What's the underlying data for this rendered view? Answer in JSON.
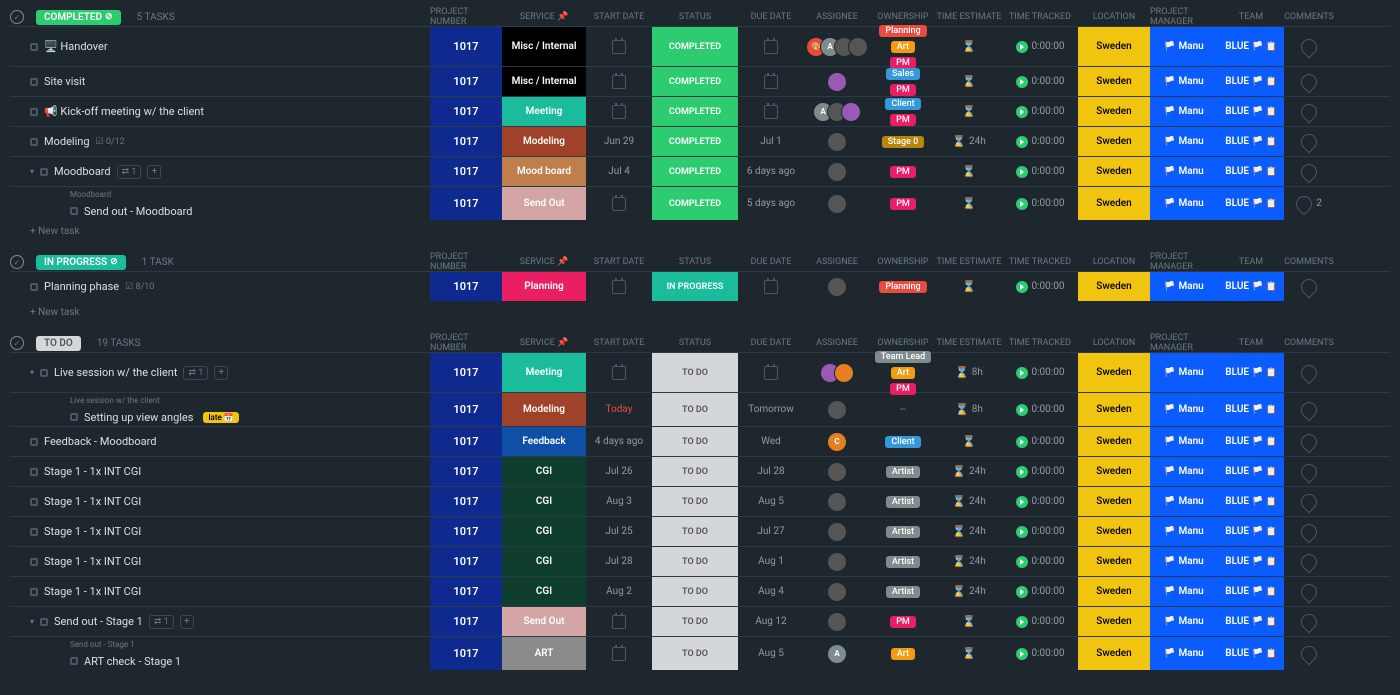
{
  "columns": {
    "project_number": "PROJECT NUMBER",
    "service": "SERVICE",
    "start_date": "START DATE",
    "status": "STATUS",
    "due_date": "DUE DATE",
    "assignee": "ASSIGNEE",
    "ownership": "OWNERSHIP",
    "time_estimate": "TIME ESTIMATE",
    "time_tracked": "TIME TRACKED",
    "location": "LOCATION",
    "project_manager": "PROJECT MANAGER",
    "team": "TEAM",
    "comments": "COMMENTS"
  },
  "new_task": "+ New task",
  "late_label": "late",
  "location_value": "Sweden",
  "pm_value": "Manu",
  "team_value": "BLUE",
  "tracked_default": "0:00:00",
  "groups": [
    {
      "name": "COMPLETED",
      "pill_class": "completed",
      "count": "5 TASKS",
      "tasks": [
        {
          "name": "🖥️ Handover",
          "proj": "1017",
          "service": "Misc / Internal",
          "service_bg": "#000",
          "start": "",
          "status": "COMPLETED",
          "status_bg": "#2ecc71",
          "due": "",
          "assignee": "group4",
          "ownership": [
            {
              "t": "Planning",
              "c": "#e74c3c"
            },
            {
              "t": "Art",
              "c": "#f39c12"
            },
            {
              "t": "PM",
              "c": "#e91e63"
            }
          ],
          "estimate": "",
          "tall": true
        },
        {
          "name": "Site visit",
          "proj": "1017",
          "service": "Misc / Internal",
          "service_bg": "#000",
          "start": "",
          "status": "COMPLETED",
          "status_bg": "#2ecc71",
          "due": "",
          "assignee": "single-purple",
          "ownership": [
            {
              "t": "Sales",
              "c": "#3498db"
            },
            {
              "t": "PM",
              "c": "#e91e63"
            }
          ],
          "estimate": ""
        },
        {
          "name": "📢 Kick-off meeting w/ the client",
          "proj": "1017",
          "service": "Meeting",
          "service_bg": "#1abc9c",
          "start": "",
          "status": "COMPLETED",
          "status_bg": "#2ecc71",
          "due": "",
          "assignee": "group3",
          "ownership": [
            {
              "t": "Client",
              "c": "#3498db"
            },
            {
              "t": "PM",
              "c": "#e91e63"
            }
          ],
          "estimate": ""
        },
        {
          "name": "Modeling",
          "proj": "1017",
          "service": "Modeling",
          "service_bg": "#a0412a",
          "start": "Jun 29",
          "status": "COMPLETED",
          "status_bg": "#2ecc71",
          "due": "Jul 1",
          "assignee": "single",
          "ownership": [
            {
              "t": "Stage 0",
              "c": "#b8860b"
            }
          ],
          "estimate": "24h",
          "progress": "0/12"
        },
        {
          "name": "Moodboard",
          "proj": "1017",
          "service": "Mood board",
          "service_bg": "#c07e4d",
          "start": "Jul 4",
          "status": "COMPLETED",
          "status_bg": "#2ecc71",
          "due": "6 days ago",
          "assignee": "single",
          "ownership": [
            {
              "t": "PM",
              "c": "#e91e63"
            }
          ],
          "estimate": "",
          "subtask_count": "1",
          "expand_chev": true
        },
        {
          "breadcrumb": "Moodboard",
          "name": "Send out - Moodboard",
          "proj": "1017",
          "service": "Send Out",
          "service_bg": "#d4a5a5",
          "start": "",
          "status": "COMPLETED",
          "status_bg": "#2ecc71",
          "due": "5 days ago",
          "assignee": "single",
          "ownership": [
            {
              "t": "PM",
              "c": "#e91e63"
            }
          ],
          "estimate": "",
          "sub": true,
          "comments": "2"
        }
      ]
    },
    {
      "name": "IN PROGRESS",
      "pill_class": "inprogress",
      "count": "1 TASK",
      "tasks": [
        {
          "name": "Planning phase",
          "proj": "1017",
          "service": "Planning",
          "service_bg": "#e91e63",
          "start": "",
          "status": "IN PROGRESS",
          "status_bg": "#1abc9c",
          "due": "",
          "assignee": "single",
          "ownership": [
            {
              "t": "Planning",
              "c": "#e74c3c"
            }
          ],
          "estimate": "",
          "progress": "8/10"
        }
      ]
    },
    {
      "name": "TO DO",
      "pill_class": "todo",
      "count": "19 TASKS",
      "tasks": [
        {
          "name": "Live session w/ the client",
          "proj": "1017",
          "service": "Meeting",
          "service_bg": "#1abc9c",
          "start": "",
          "status": "TO DO",
          "status_bg": "#d3d7d9",
          "status_fg": "#555",
          "due": "",
          "assignee": "pair",
          "ownership": [
            {
              "t": "Team Lead",
              "c": "#7f8c8d"
            },
            {
              "t": "Art",
              "c": "#f39c12"
            },
            {
              "t": "PM",
              "c": "#e91e63"
            }
          ],
          "estimate": "8h",
          "tall": true,
          "subtask_count": "1",
          "expand_chev": true
        },
        {
          "breadcrumb": "Live session w/ the client",
          "name": "Setting up view angles",
          "proj": "1017",
          "service": "Modeling",
          "service_bg": "#a0412a",
          "start": "Today",
          "start_today": true,
          "status": "TO DO",
          "status_bg": "#d3d7d9",
          "status_fg": "#555",
          "due": "Tomorrow",
          "assignee": "single-img",
          "ownership": "dash",
          "estimate": "8h",
          "sub": true,
          "late": true
        },
        {
          "name": "Feedback - Moodboard",
          "proj": "1017",
          "service": "Feedback",
          "service_bg": "#0f4fa8",
          "start": "4 days ago",
          "status": "TO DO",
          "status_bg": "#d3d7d9",
          "status_fg": "#555",
          "due": "Wed",
          "assignee": "single-orange",
          "ownership": [
            {
              "t": "Client",
              "c": "#3498db"
            }
          ],
          "estimate": ""
        },
        {
          "name": "Stage 1 - 1x INT CGI",
          "proj": "1017",
          "service": "CGI",
          "service_bg": "#0f3d2e",
          "start": "Jul 26",
          "status": "TO DO",
          "status_bg": "#d3d7d9",
          "status_fg": "#555",
          "due": "Jul 28",
          "assignee": "single-img",
          "ownership": [
            {
              "t": "Artist",
              "c": "#7f8c8d"
            }
          ],
          "estimate": "24h"
        },
        {
          "name": "Stage 1 - 1x INT CGI",
          "proj": "1017",
          "service": "CGI",
          "service_bg": "#0f3d2e",
          "start": "Aug 3",
          "status": "TO DO",
          "status_bg": "#d3d7d9",
          "status_fg": "#555",
          "due": "Aug 5",
          "assignee": "single-img",
          "ownership": [
            {
              "t": "Artist",
              "c": "#7f8c8d"
            }
          ],
          "estimate": "24h"
        },
        {
          "name": "Stage 1 - 1x INT CGI",
          "proj": "1017",
          "service": "CGI",
          "service_bg": "#0f3d2e",
          "start": "Jul 25",
          "status": "TO DO",
          "status_bg": "#d3d7d9",
          "status_fg": "#555",
          "due": "Jul 27",
          "assignee": "single",
          "ownership": [
            {
              "t": "Artist",
              "c": "#7f8c8d"
            }
          ],
          "estimate": "24h"
        },
        {
          "name": "Stage 1 - 1x INT CGI",
          "proj": "1017",
          "service": "CGI",
          "service_bg": "#0f3d2e",
          "start": "Jul 28",
          "status": "TO DO",
          "status_bg": "#d3d7d9",
          "status_fg": "#555",
          "due": "Aug 1",
          "assignee": "single",
          "ownership": [
            {
              "t": "Artist",
              "c": "#7f8c8d"
            }
          ],
          "estimate": "24h"
        },
        {
          "name": "Stage 1 - 1x INT CGI",
          "proj": "1017",
          "service": "CGI",
          "service_bg": "#0f3d2e",
          "start": "Aug 2",
          "status": "TO DO",
          "status_bg": "#d3d7d9",
          "status_fg": "#555",
          "due": "Aug 4",
          "assignee": "single",
          "ownership": [
            {
              "t": "Artist",
              "c": "#7f8c8d"
            }
          ],
          "estimate": "24h"
        },
        {
          "name": "Send out - Stage 1",
          "proj": "1017",
          "service": "Send Out",
          "service_bg": "#d4a5a5",
          "start": "",
          "status": "TO DO",
          "status_bg": "#d3d7d9",
          "status_fg": "#555",
          "due": "Aug 12",
          "assignee": "single",
          "ownership": [
            {
              "t": "PM",
              "c": "#e91e63"
            }
          ],
          "estimate": "",
          "subtask_count": "1",
          "expand_chev": true
        },
        {
          "breadcrumb": "Send out - Stage 1",
          "name": "ART check - Stage 1",
          "proj": "1017",
          "service": "ART",
          "service_bg": "#8a8a8a",
          "start": "",
          "status": "TO DO",
          "status_bg": "#d3d7d9",
          "status_fg": "#555",
          "due": "Aug 5",
          "assignee": "single-a",
          "ownership": [
            {
              "t": "Art",
              "c": "#f39c12"
            }
          ],
          "estimate": "",
          "sub": true
        }
      ]
    }
  ]
}
